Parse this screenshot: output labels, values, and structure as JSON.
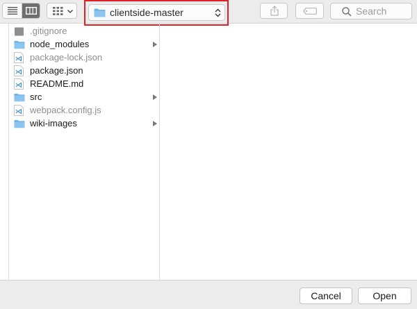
{
  "toolbar": {
    "view_list_icon": "list-view-icon",
    "view_column_icon": "column-view-icon",
    "group_icon": "grid-group-icon",
    "path": {
      "folder_name": "clientside-master",
      "icon": "folder-icon"
    },
    "share_icon": "share-icon",
    "tag_icon": "tag-icon",
    "search": {
      "placeholder": "Search",
      "icon": "search-icon"
    }
  },
  "files": [
    {
      "name": ".gitignore",
      "kind": "generic",
      "dim": true,
      "has_children": false
    },
    {
      "name": "node_modules",
      "kind": "folder",
      "dim": false,
      "has_children": true
    },
    {
      "name": "package-lock.json",
      "kind": "vscode",
      "dim": true,
      "has_children": false
    },
    {
      "name": "package.json",
      "kind": "vscode",
      "dim": false,
      "has_children": false
    },
    {
      "name": "README.md",
      "kind": "vscode",
      "dim": false,
      "has_children": false
    },
    {
      "name": "src",
      "kind": "folder",
      "dim": false,
      "has_children": true
    },
    {
      "name": "webpack.config.js",
      "kind": "vscode",
      "dim": true,
      "has_children": false
    },
    {
      "name": "wiki-images",
      "kind": "folder",
      "dim": false,
      "has_children": true
    }
  ],
  "footer": {
    "cancel_label": "Cancel",
    "open_label": "Open"
  },
  "colors": {
    "highlight_border": "#e01f26",
    "folder": "#6fb3e8",
    "toolbar_bg": "#ececec"
  }
}
